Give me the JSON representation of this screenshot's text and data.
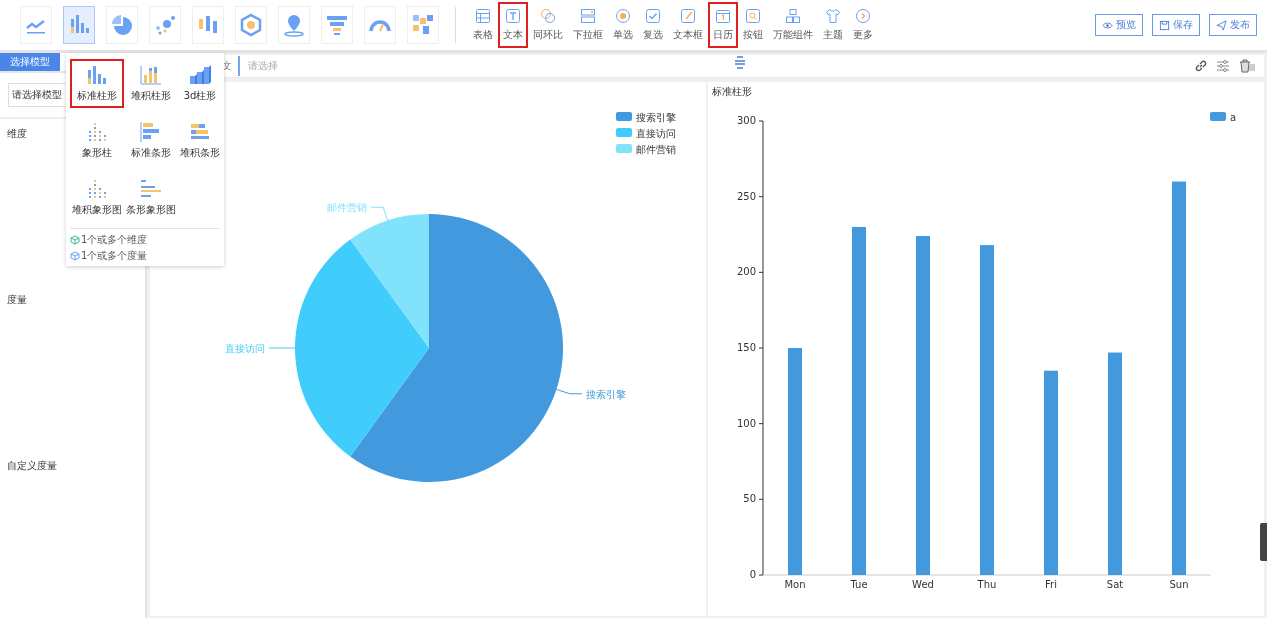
{
  "chart_types": [
    {
      "kind": "line",
      "selected": false
    },
    {
      "kind": "bar",
      "selected": true
    },
    {
      "kind": "pie",
      "selected": false
    },
    {
      "kind": "scatter",
      "selected": false
    },
    {
      "kind": "candle",
      "selected": false
    },
    {
      "kind": "radar",
      "selected": false
    },
    {
      "kind": "map",
      "selected": false
    },
    {
      "kind": "funnel",
      "selected": false
    },
    {
      "kind": "gauge",
      "selected": false
    },
    {
      "kind": "heatmap",
      "selected": false
    }
  ],
  "widgets": [
    {
      "kind": "table",
      "label": "表格",
      "highlighted": false
    },
    {
      "kind": "text",
      "label": "文本",
      "highlighted": true
    },
    {
      "kind": "ratio",
      "label": "同环比",
      "highlighted": false
    },
    {
      "kind": "dropdown",
      "label": "下拉框",
      "highlighted": false
    },
    {
      "kind": "radio",
      "label": "单选",
      "highlighted": false
    },
    {
      "kind": "checkbox",
      "label": "复选",
      "highlighted": false
    },
    {
      "kind": "textbox",
      "label": "文本框",
      "highlighted": false
    },
    {
      "kind": "calendar",
      "label": "日历",
      "highlighted": true
    },
    {
      "kind": "button",
      "label": "按钮",
      "highlighted": false
    },
    {
      "kind": "blocks",
      "label": "万能组件",
      "highlighted": false
    },
    {
      "kind": "shirt",
      "label": "主题",
      "highlighted": false
    },
    {
      "kind": "more",
      "label": "更多",
      "highlighted": false
    }
  ],
  "actions": [
    {
      "kind": "eye",
      "label": "预览"
    },
    {
      "kind": "save",
      "label": "保存"
    },
    {
      "kind": "send",
      "label": "发布"
    }
  ],
  "sidebar": {
    "tab": "选择模型",
    "select_placeholder": "请选择模型",
    "sections": [
      "维度",
      "度量",
      "自定义度量"
    ]
  },
  "chart_menu": {
    "items": [
      {
        "kind": "bar",
        "label": "标准柱形",
        "highlighted": true
      },
      {
        "kind": "stacked",
        "label": "堆积柱形",
        "highlighted": false
      },
      {
        "kind": "bar3d",
        "label": "3d柱形",
        "highlighted": false
      },
      {
        "kind": "pictorial",
        "label": "象形柱",
        "highlighted": false
      },
      {
        "kind": "hbar",
        "label": "标准条形",
        "highlighted": false
      },
      {
        "kind": "hstacked",
        "label": "堆积条形",
        "highlighted": false
      },
      {
        "kind": "pictorial",
        "label": "堆积象形图",
        "highlighted": false
      },
      {
        "kind": "hpictorial",
        "label": "条形象形图",
        "highlighted": false
      }
    ],
    "hints": [
      "1个或多个维度",
      "1个或多个度量"
    ]
  },
  "filter": {
    "label": "文",
    "placeholder": "请选择"
  },
  "pie_panel": {
    "chart_data": {
      "type": "pie",
      "categories": [
        "搜索引擎",
        "直接访问",
        "邮件营销"
      ],
      "values": [
        60,
        30,
        10
      ],
      "colors": [
        "#4299dd",
        "#40cdfb",
        "#80e3fb"
      ],
      "legend": "top-right"
    }
  },
  "bar_panel": {
    "title": "标准柱形",
    "chart_data": {
      "type": "bar",
      "categories": [
        "Mon",
        "Tue",
        "Wed",
        "Thu",
        "Fri",
        "Sat",
        "Sun"
      ],
      "series": [
        {
          "name": "a",
          "color": "#4299dd",
          "values": [
            150,
            230,
            224,
            218,
            135,
            147,
            260
          ]
        }
      ],
      "legend": "top-right",
      "ylim": [
        0,
        300
      ],
      "yticks": [
        0,
        50,
        100,
        150,
        200,
        250,
        300
      ]
    }
  }
}
